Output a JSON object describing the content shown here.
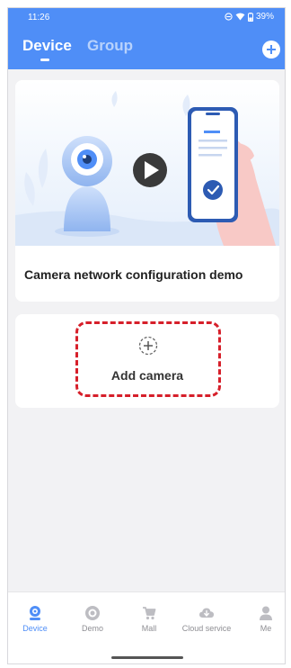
{
  "status_bar": {
    "time": "11:26",
    "battery": "39%"
  },
  "header": {
    "tabs": [
      {
        "label": "Device",
        "active": true
      },
      {
        "label": "Group",
        "active": false
      }
    ]
  },
  "demo_card": {
    "title": "Camera network configuration demo"
  },
  "add_card": {
    "label": "Add camera"
  },
  "tabbar": {
    "items": [
      {
        "label": "Device",
        "icon": "camera-icon",
        "active": true
      },
      {
        "label": "Demo",
        "icon": "demo-icon",
        "active": false
      },
      {
        "label": "Mall",
        "icon": "cart-icon",
        "active": false
      },
      {
        "label": "Cloud service",
        "icon": "cloud-icon",
        "active": false
      },
      {
        "label": "Me",
        "icon": "person-icon",
        "active": false
      }
    ]
  },
  "colors": {
    "accent": "#4f8ef7",
    "highlight": "#d61f2a",
    "background": "#f2f2f4"
  }
}
